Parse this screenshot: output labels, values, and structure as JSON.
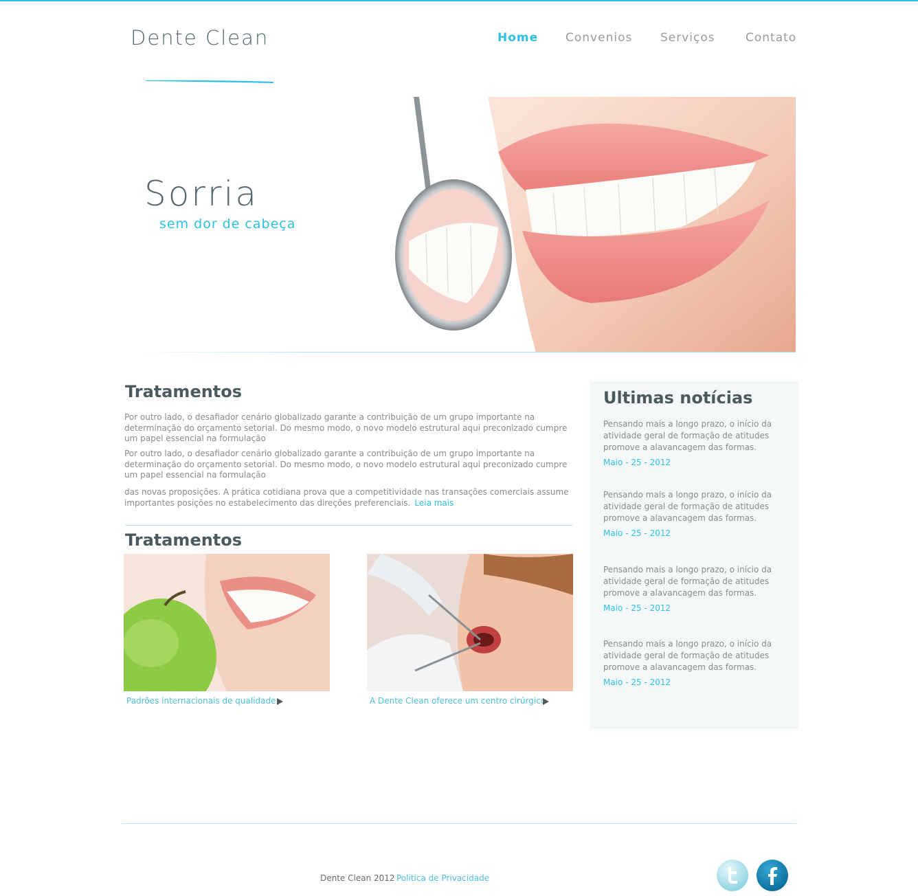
{
  "header": {
    "logo": "Dente Clean",
    "nav": [
      {
        "label": "Home",
        "active": true
      },
      {
        "label": "Convenios",
        "active": false
      },
      {
        "label": "Serviços",
        "active": false
      },
      {
        "label": "Contato",
        "active": false
      }
    ]
  },
  "hero": {
    "title": "Sorria",
    "subtitle": "sem dor de cabeça"
  },
  "main": {
    "section1_title": "Tratamentos",
    "paragraphs": [
      "Por outro lado, o desafiador cenário globalizado garante a contribuição de um grupo importante na determinação do orçamento setorial. Do mesmo modo, o novo modelo estrutural aqui preconizado cumpre um papel essencial na formulação",
      "Por outro lado, o desafiador cenário globalizado garante a contribuição de um grupo importante na determinação do orçamento setorial. Do mesmo modo, o novo modelo estrutural aqui preconizado cumpre um papel essencial na formulação",
      "das novas proposições. A prática cotidiana prova que a competitividade nas transações comerciais assume importantes posições no estabelecimento das direções preferenciais."
    ],
    "read_more": "Leia mais",
    "section2_title": "Tratamentos",
    "thumbs": [
      {
        "caption": "Padrões internacionais de qualidade",
        "icon": "play-arrow-icon"
      },
      {
        "caption": "A Dente Clean oferece um centro cirúrgico",
        "icon": "play-arrow-icon"
      }
    ]
  },
  "sidebar": {
    "title": "Ultimas notícias",
    "news": [
      {
        "text": "Pensando mais a longo prazo, o início da atividade geral de formação de atitudes promove a alavancagem das formas.",
        "date": "Maio - 25 - 2012"
      },
      {
        "text": "Pensando mais a longo prazo, o início da atividade geral de formação de atitudes promove a alavancagem das formas.",
        "date": "Maio - 25 - 2012"
      },
      {
        "text": "Pensando mais a longo prazo, o início da atividade geral de formação de atitudes promove a alavancagem das formas.",
        "date": "Maio - 25 - 2012"
      },
      {
        "text": "Pensando mais a longo prazo, o início da atividade geral de formação de atitudes promove a alavancagem das formas.",
        "date": "Maio - 25 - 2012"
      }
    ]
  },
  "footer": {
    "copyright": "Dente Clean 2012",
    "privacy": "Politica de Privacidade",
    "social": [
      "twitter-icon",
      "facebook-icon"
    ]
  },
  "colors": {
    "accent": "#2cc1e3",
    "heading": "#4a5a5f",
    "body_text": "#8a8a8a",
    "sidebar_bg": "#f5f8f9"
  }
}
